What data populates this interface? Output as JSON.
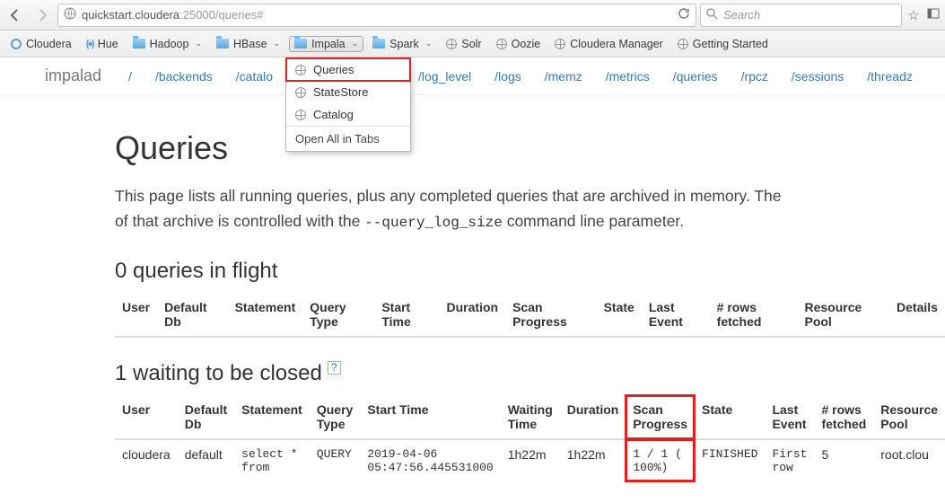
{
  "browser": {
    "url_host": "quickstart.cloudera",
    "url_rest": ":25000/queries#",
    "search_placeholder": "Search"
  },
  "bookmarks": {
    "items": [
      {
        "label": "Cloudera",
        "icon": "cloudera",
        "dropdown": false
      },
      {
        "label": "Hue",
        "icon": "hue",
        "dropdown": false
      },
      {
        "label": "Hadoop",
        "icon": "folder",
        "dropdown": true
      },
      {
        "label": "HBase",
        "icon": "folder",
        "dropdown": true
      },
      {
        "label": "Impala",
        "icon": "folder",
        "dropdown": true,
        "open": true
      },
      {
        "label": "Spark",
        "icon": "folder",
        "dropdown": true
      },
      {
        "label": "Solr",
        "icon": "globe",
        "dropdown": false
      },
      {
        "label": "Oozie",
        "icon": "globe",
        "dropdown": false
      },
      {
        "label": "Cloudera Manager",
        "icon": "globe",
        "dropdown": false
      },
      {
        "label": "Getting Started",
        "icon": "globe",
        "dropdown": false
      }
    ]
  },
  "dropdown": {
    "items": [
      "Queries",
      "StateStore",
      "Catalog"
    ],
    "open_all": "Open All in Tabs"
  },
  "topnav": {
    "brand": "impalad",
    "links": [
      "/",
      "/backends",
      "/catalo",
      "",
      "/log_level",
      "/logs",
      "/memz",
      "/metrics",
      "/queries",
      "/rpcz",
      "/sessions",
      "/threadz"
    ]
  },
  "page": {
    "h1": "Queries",
    "desc_pre": "This page lists all running queries, plus any completed queries that are archived in memory. The ",
    "desc_mid": "of that archive is controlled with the ",
    "desc_code": "--query_log_size",
    "desc_post": " command line parameter.",
    "h2_inflight": "0 queries in flight",
    "h2_waiting": "1 waiting to be closed ",
    "hint": "?"
  },
  "t1": {
    "headers": [
      "User",
      "Default Db",
      "Statement",
      "Query Type",
      "Start Time",
      "Duration",
      "Scan Progress",
      "State",
      "Last Event",
      "# rows fetched",
      "Resource Pool",
      "Details"
    ]
  },
  "t2": {
    "headers": [
      "User",
      "Default Db",
      "Statement",
      "Query Type",
      "Start Time",
      "Waiting Time",
      "Duration",
      "Scan Progress",
      "State",
      "Last Event",
      "# rows fetched",
      "Resource Pool"
    ],
    "row": {
      "user": "cloudera",
      "db": "default",
      "stmt": "select * from",
      "qtype": "QUERY",
      "start": "2019-04-06 05:47:56.445531000",
      "wait": "1h22m",
      "dur": "1h22m",
      "scan": "1 / 1 ( 100%)",
      "state": "FINISHED",
      "last": "First row",
      "rows": "5",
      "pool": "root.clou"
    }
  }
}
